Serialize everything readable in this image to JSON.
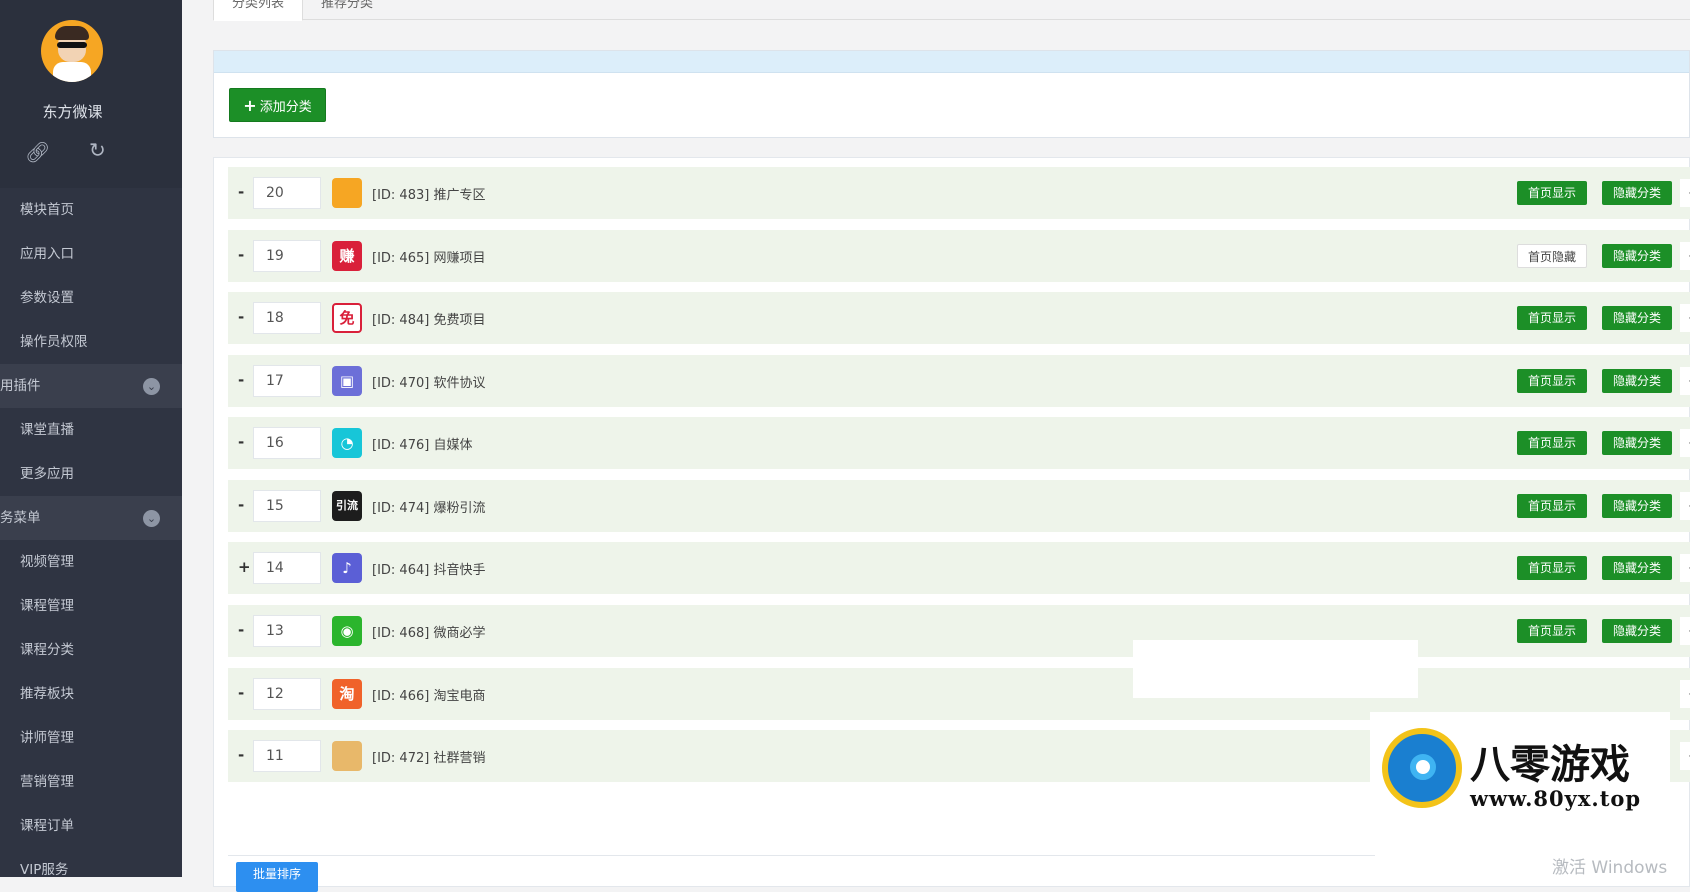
{
  "sidebar": {
    "username": "东方微课",
    "icons": [
      "link-icon",
      "refresh-icon"
    ],
    "items": [
      {
        "label": "模块首页",
        "type": "item"
      },
      {
        "label": "应用入口",
        "type": "item"
      },
      {
        "label": "参数设置",
        "type": "item"
      },
      {
        "label": "操作员权限",
        "type": "item"
      },
      {
        "label": "用插件",
        "type": "group"
      },
      {
        "label": "课堂直播",
        "type": "item"
      },
      {
        "label": "更多应用",
        "type": "item"
      },
      {
        "label": "务菜单",
        "type": "group"
      },
      {
        "label": "视频管理",
        "type": "item"
      },
      {
        "label": "课程管理",
        "type": "item"
      },
      {
        "label": "课程分类",
        "type": "item"
      },
      {
        "label": "推荐板块",
        "type": "item"
      },
      {
        "label": "讲师管理",
        "type": "item"
      },
      {
        "label": "营销管理",
        "type": "item"
      },
      {
        "label": "课程订单",
        "type": "item"
      },
      {
        "label": "VIP服务",
        "type": "item"
      }
    ]
  },
  "tabs": [
    {
      "label": "分类列表",
      "active": true
    },
    {
      "label": "推荐分类",
      "active": false
    }
  ],
  "toolbar": {
    "add_label": "添加分类"
  },
  "categories": [
    {
      "sign": "-",
      "order": "20",
      "title": "[ID: 483] 推广专区",
      "icon": "avatar-icon",
      "icon_color": "#f6a623",
      "icon_text": "",
      "show_label": "首页显示",
      "show_on": true,
      "hide_label": "隐藏分类"
    },
    {
      "sign": "-",
      "order": "19",
      "title": "[ID: 465] 网赚项目",
      "icon": "earn-icon",
      "icon_color": "#d9203a",
      "icon_text": "赚",
      "show_label": "首页隐藏",
      "show_on": false,
      "hide_label": "隐藏分类"
    },
    {
      "sign": "-",
      "order": "18",
      "title": "[ID: 484] 免费项目",
      "icon": "free-icon",
      "icon_color": "#ffffff",
      "icon_text": "免",
      "show_label": "首页显示",
      "show_on": true,
      "hide_label": "隐藏分类"
    },
    {
      "sign": "-",
      "order": "17",
      "title": "[ID: 470] 软件协议",
      "icon": "briefcase-icon",
      "icon_color": "#6c6fd8",
      "icon_text": "▣",
      "show_label": "首页显示",
      "show_on": true,
      "hide_label": "隐藏分类"
    },
    {
      "sign": "-",
      "order": "16",
      "title": "[ID: 476] 自媒体",
      "icon": "media-icon",
      "icon_color": "#17c6d8",
      "icon_text": "◔",
      "show_label": "首页显示",
      "show_on": true,
      "hide_label": "隐藏分类"
    },
    {
      "sign": "-",
      "order": "15",
      "title": "[ID: 474] 爆粉引流",
      "icon": "traffic-icon",
      "icon_color": "#1d1d1d",
      "icon_text": "引流",
      "show_label": "首页显示",
      "show_on": true,
      "hide_label": "隐藏分类"
    },
    {
      "sign": "+",
      "order": "14",
      "title": "[ID: 464] 抖音快手",
      "icon": "tiktok-icon",
      "icon_color": "#5b5fd6",
      "icon_text": "♪",
      "show_label": "首页显示",
      "show_on": true,
      "hide_label": "隐藏分类"
    },
    {
      "sign": "-",
      "order": "13",
      "title": "[ID: 468] 微商必学",
      "icon": "wechat-icon",
      "icon_color": "#2bb52d",
      "icon_text": "◉",
      "show_label": "首页显示",
      "show_on": true,
      "hide_label": "隐藏分类"
    },
    {
      "sign": "-",
      "order": "12",
      "title": "[ID: 466] 淘宝电商",
      "icon": "taobao-icon",
      "icon_color": "#f0622a",
      "icon_text": "淘",
      "show_label": "",
      "show_on": null,
      "hide_label": ""
    },
    {
      "sign": "-",
      "order": "11",
      "title": "[ID: 472] 社群营销",
      "icon": "community-icon",
      "icon_color": "#e8b86a",
      "icon_text": "",
      "show_label": "",
      "show_on": null,
      "hide_label": ""
    }
  ],
  "batch_label": "批量排序",
  "watermark": {
    "title": "八零游戏",
    "url": "www.80yx.top"
  },
  "activate_text": "激活 Windows"
}
